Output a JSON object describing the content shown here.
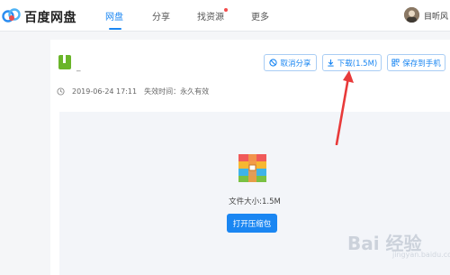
{
  "app": {
    "logo_text": "百度网盘"
  },
  "nav": {
    "items": [
      {
        "label": "网盘"
      },
      {
        "label": "分享"
      },
      {
        "label": "找资源"
      },
      {
        "label": "更多"
      }
    ]
  },
  "user": {
    "name": "目听风"
  },
  "share": {
    "file_name": "_",
    "actions": {
      "cancel_share": "取消分享",
      "download": "下载(1.5M)",
      "save_to_phone": "保存到手机"
    },
    "time": "2019-06-24 17:11",
    "expiry_label": "失效时间：永久有效",
    "size_text": "文件大小:1.5M",
    "open_zip": "打开压缩包"
  },
  "watermark": {
    "text": "Bai 经验",
    "sub": "jingyan.baidu.com"
  },
  "colors": {
    "accent": "#1a86f2",
    "arrow": "#e83a3a",
    "file_icon": "#6ab52a"
  }
}
